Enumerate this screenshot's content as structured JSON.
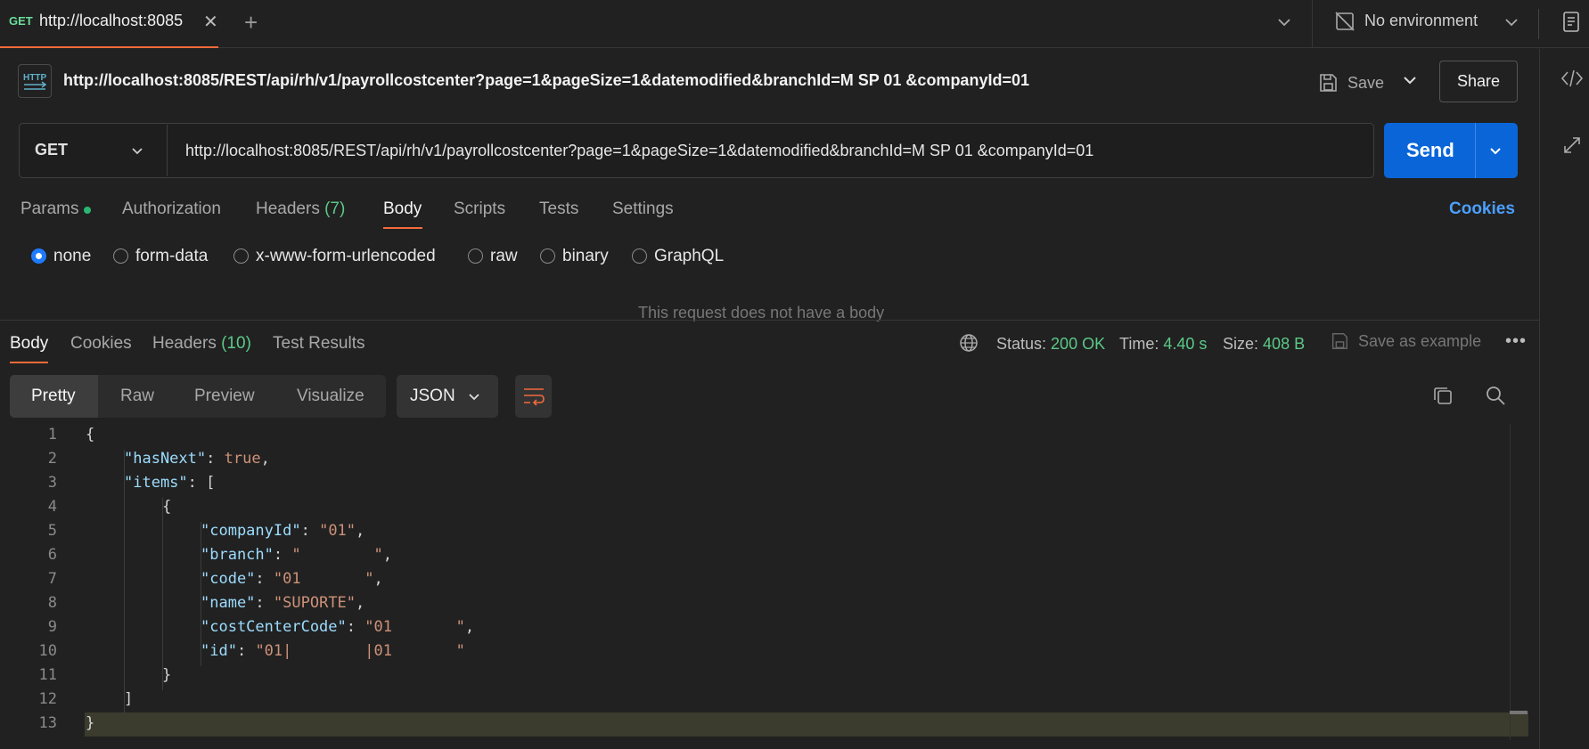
{
  "tab": {
    "method": "GET",
    "url": "http://localhost:8085"
  },
  "environment": {
    "label": "No environment"
  },
  "title": {
    "url": "http://localhost:8085/REST/api/rh/v1/payrollcostcenter?page=1&pageSize=1&datemodified&branchId=M SP 01 &companyId=01"
  },
  "actions": {
    "save": "Save",
    "share": "Share"
  },
  "request": {
    "method": "GET",
    "url": "http://localhost:8085/REST/api/rh/v1/payrollcostcenter?page=1&pageSize=1&datemodified&branchId=M SP 01 &companyId=01",
    "send": "Send"
  },
  "request_tabs": {
    "params": "Params",
    "authorization": "Authorization",
    "headers": "Headers",
    "headers_count": "(7)",
    "body": "Body",
    "scripts": "Scripts",
    "tests": "Tests",
    "settings": "Settings",
    "cookies": "Cookies",
    "active": "Body"
  },
  "body_types": {
    "none": "none",
    "form_data": "form-data",
    "urlencoded": "x-www-form-urlencoded",
    "raw": "raw",
    "binary": "binary",
    "graphql": "GraphQL",
    "selected": "none"
  },
  "no_body_message": "This request does not have a body",
  "response_tabs": {
    "body": "Body",
    "cookies": "Cookies",
    "headers": "Headers",
    "headers_count": "(10)",
    "test_results": "Test Results"
  },
  "response_meta": {
    "status_label": "Status:",
    "status": "200 OK",
    "time_label": "Time:",
    "time": "4.40 s",
    "size_label": "Size:",
    "size": "408 B",
    "save_example": "Save as example"
  },
  "view_modes": {
    "pretty": "Pretty",
    "raw": "Raw",
    "preview": "Preview",
    "visualize": "Visualize",
    "active": "Pretty"
  },
  "language": "JSON",
  "code_lines": [
    "1",
    "2",
    "3",
    "4",
    "5",
    "6",
    "7",
    "8",
    "9",
    "10",
    "11",
    "12",
    "13"
  ],
  "json": {
    "has_next_key": "\"hasNext\"",
    "has_next_val": "true",
    "items_key": "\"items\"",
    "company_key": "\"companyId\"",
    "company_val": "\"01\"",
    "branch_key": "\"branch\"",
    "branch_val": "\"        \"",
    "code_key": "\"code\"",
    "code_val": "\"01       \"",
    "name_key": "\"name\"",
    "name_val": "\"SUPORTE\"",
    "cc_key": "\"costCenterCode\"",
    "cc_val": "\"01       \"",
    "id_key": "\"id\"",
    "id_val": "\"01|        |01       \""
  },
  "colors": {
    "accent": "#f26b3a",
    "send": "#0a66d8",
    "success": "#5bc987",
    "link": "#4b9fff"
  },
  "icons": [
    "close-icon",
    "plus-icon",
    "chevron-down-icon",
    "no-environment-icon",
    "document-icon",
    "http-icon",
    "save-icon",
    "code-icon",
    "sync-icon",
    "globe-icon",
    "more-icon",
    "wrap-icon",
    "copy-icon",
    "search-icon"
  ]
}
